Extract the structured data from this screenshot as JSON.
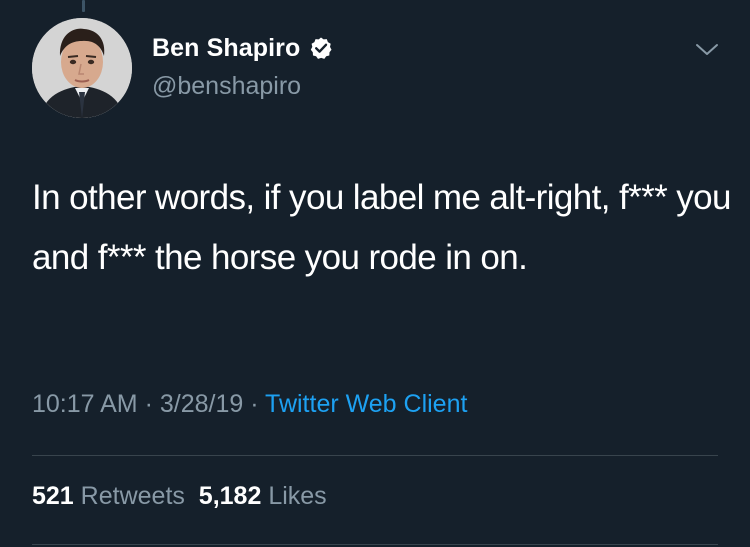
{
  "tweet": {
    "author": {
      "display_name": "Ben Shapiro",
      "handle": "@benshapiro",
      "verified": true,
      "verified_icon": "verified-badge-icon"
    },
    "more_icon": "chevron-down-icon",
    "text": "In other words, if you label me alt-right, f*** you and f*** the horse you rode in on.",
    "meta": {
      "time": "10:17 AM",
      "separator": " · ",
      "date": "3/28/19",
      "source": "Twitter Web Client"
    },
    "stats": {
      "retweets_count": "521",
      "retweets_label": "Retweets",
      "likes_count": "5,182",
      "likes_label": "Likes"
    }
  },
  "colors": {
    "background": "#15202b",
    "primary_text": "#ffffff",
    "secondary_text": "#8899a6",
    "accent": "#1da1f2",
    "divider": "#38444d"
  }
}
